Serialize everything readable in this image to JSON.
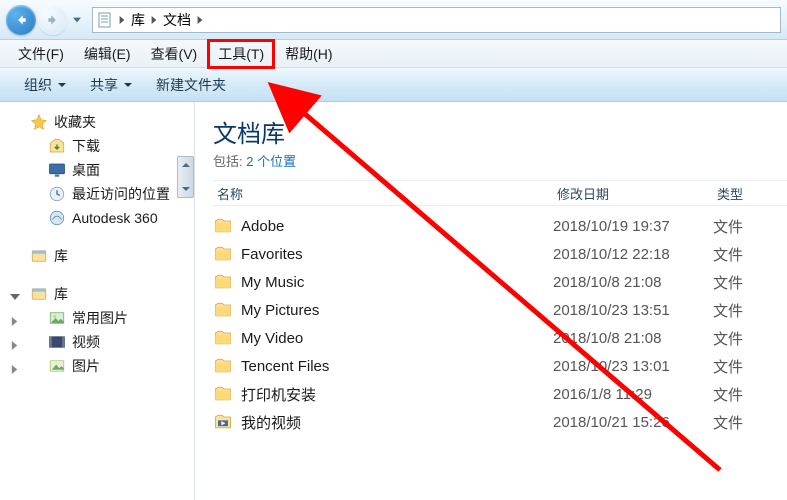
{
  "nav": {
    "breadcrumb": [
      {
        "label": "库"
      },
      {
        "label": "文档"
      }
    ]
  },
  "menu": [
    {
      "id": "file",
      "label": "文件(F)"
    },
    {
      "id": "edit",
      "label": "编辑(E)"
    },
    {
      "id": "view",
      "label": "查看(V)"
    },
    {
      "id": "tools",
      "label": "工具(T)",
      "highlighted": true
    },
    {
      "id": "help",
      "label": "帮助(H)"
    }
  ],
  "cmd": {
    "organize": "组织",
    "share": "共享",
    "newfolder": "新建文件夹"
  },
  "sidebar": {
    "favorites": {
      "label": "收藏夹",
      "items": [
        {
          "id": "downloads",
          "label": "下载"
        },
        {
          "id": "desktop",
          "label": "桌面"
        },
        {
          "id": "recent",
          "label": "最近访问的位置"
        },
        {
          "id": "autodesk",
          "label": "Autodesk 360"
        }
      ]
    },
    "library_nav": {
      "label": "库"
    },
    "library": {
      "label": "库",
      "items": [
        {
          "id": "pictures",
          "label": "常用图片"
        },
        {
          "id": "videos",
          "label": "视频"
        },
        {
          "id": "images",
          "label": "图片"
        }
      ]
    }
  },
  "content": {
    "title": "文档库",
    "includes_prefix": "包括: ",
    "includes_link": "2 个位置",
    "columns": {
      "name": "名称",
      "date": "修改日期",
      "type": "类型"
    },
    "files": [
      {
        "name": "Adobe",
        "date": "2018/10/19 19:37",
        "type": "文件"
      },
      {
        "name": "Favorites",
        "date": "2018/10/12 22:18",
        "type": "文件"
      },
      {
        "name": "My Music",
        "date": "2018/10/8 21:08",
        "type": "文件"
      },
      {
        "name": "My Pictures",
        "date": "2018/10/23 13:51",
        "type": "文件"
      },
      {
        "name": "My Video",
        "date": "2018/10/8 21:08",
        "type": "文件"
      },
      {
        "name": "Tencent Files",
        "date": "2018/10/23 13:01",
        "type": "文件"
      },
      {
        "name": "打印机安装",
        "date": "2016/1/8 11:29",
        "type": "文件"
      },
      {
        "name": "我的视频",
        "date": "2018/10/21 15:26",
        "type": "文件"
      }
    ]
  }
}
